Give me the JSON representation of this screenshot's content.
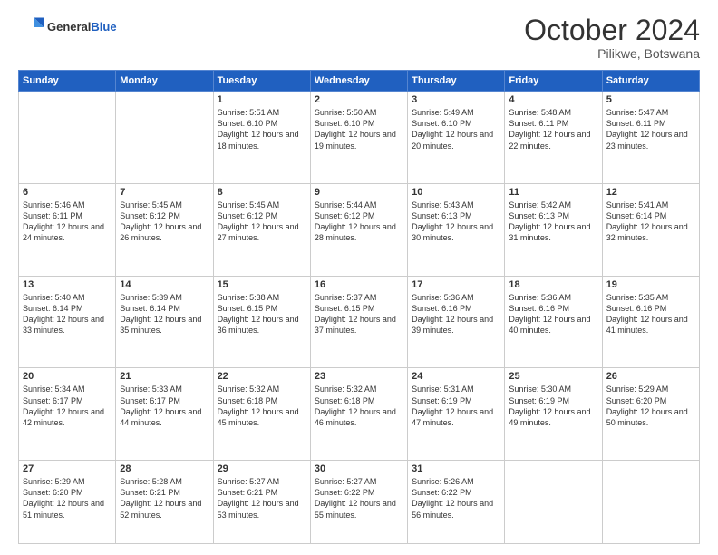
{
  "header": {
    "logo_general": "General",
    "logo_blue": "Blue",
    "month": "October 2024",
    "location": "Pilikwe, Botswana"
  },
  "days_of_week": [
    "Sunday",
    "Monday",
    "Tuesday",
    "Wednesday",
    "Thursday",
    "Friday",
    "Saturday"
  ],
  "weeks": [
    [
      {
        "day": "",
        "content": ""
      },
      {
        "day": "",
        "content": ""
      },
      {
        "day": "1",
        "content": "Sunrise: 5:51 AM\nSunset: 6:10 PM\nDaylight: 12 hours and 18 minutes."
      },
      {
        "day": "2",
        "content": "Sunrise: 5:50 AM\nSunset: 6:10 PM\nDaylight: 12 hours and 19 minutes."
      },
      {
        "day": "3",
        "content": "Sunrise: 5:49 AM\nSunset: 6:10 PM\nDaylight: 12 hours and 20 minutes."
      },
      {
        "day": "4",
        "content": "Sunrise: 5:48 AM\nSunset: 6:11 PM\nDaylight: 12 hours and 22 minutes."
      },
      {
        "day": "5",
        "content": "Sunrise: 5:47 AM\nSunset: 6:11 PM\nDaylight: 12 hours and 23 minutes."
      }
    ],
    [
      {
        "day": "6",
        "content": "Sunrise: 5:46 AM\nSunset: 6:11 PM\nDaylight: 12 hours and 24 minutes."
      },
      {
        "day": "7",
        "content": "Sunrise: 5:45 AM\nSunset: 6:12 PM\nDaylight: 12 hours and 26 minutes."
      },
      {
        "day": "8",
        "content": "Sunrise: 5:45 AM\nSunset: 6:12 PM\nDaylight: 12 hours and 27 minutes."
      },
      {
        "day": "9",
        "content": "Sunrise: 5:44 AM\nSunset: 6:12 PM\nDaylight: 12 hours and 28 minutes."
      },
      {
        "day": "10",
        "content": "Sunrise: 5:43 AM\nSunset: 6:13 PM\nDaylight: 12 hours and 30 minutes."
      },
      {
        "day": "11",
        "content": "Sunrise: 5:42 AM\nSunset: 6:13 PM\nDaylight: 12 hours and 31 minutes."
      },
      {
        "day": "12",
        "content": "Sunrise: 5:41 AM\nSunset: 6:14 PM\nDaylight: 12 hours and 32 minutes."
      }
    ],
    [
      {
        "day": "13",
        "content": "Sunrise: 5:40 AM\nSunset: 6:14 PM\nDaylight: 12 hours and 33 minutes."
      },
      {
        "day": "14",
        "content": "Sunrise: 5:39 AM\nSunset: 6:14 PM\nDaylight: 12 hours and 35 minutes."
      },
      {
        "day": "15",
        "content": "Sunrise: 5:38 AM\nSunset: 6:15 PM\nDaylight: 12 hours and 36 minutes."
      },
      {
        "day": "16",
        "content": "Sunrise: 5:37 AM\nSunset: 6:15 PM\nDaylight: 12 hours and 37 minutes."
      },
      {
        "day": "17",
        "content": "Sunrise: 5:36 AM\nSunset: 6:16 PM\nDaylight: 12 hours and 39 minutes."
      },
      {
        "day": "18",
        "content": "Sunrise: 5:36 AM\nSunset: 6:16 PM\nDaylight: 12 hours and 40 minutes."
      },
      {
        "day": "19",
        "content": "Sunrise: 5:35 AM\nSunset: 6:16 PM\nDaylight: 12 hours and 41 minutes."
      }
    ],
    [
      {
        "day": "20",
        "content": "Sunrise: 5:34 AM\nSunset: 6:17 PM\nDaylight: 12 hours and 42 minutes."
      },
      {
        "day": "21",
        "content": "Sunrise: 5:33 AM\nSunset: 6:17 PM\nDaylight: 12 hours and 44 minutes."
      },
      {
        "day": "22",
        "content": "Sunrise: 5:32 AM\nSunset: 6:18 PM\nDaylight: 12 hours and 45 minutes."
      },
      {
        "day": "23",
        "content": "Sunrise: 5:32 AM\nSunset: 6:18 PM\nDaylight: 12 hours and 46 minutes."
      },
      {
        "day": "24",
        "content": "Sunrise: 5:31 AM\nSunset: 6:19 PM\nDaylight: 12 hours and 47 minutes."
      },
      {
        "day": "25",
        "content": "Sunrise: 5:30 AM\nSunset: 6:19 PM\nDaylight: 12 hours and 49 minutes."
      },
      {
        "day": "26",
        "content": "Sunrise: 5:29 AM\nSunset: 6:20 PM\nDaylight: 12 hours and 50 minutes."
      }
    ],
    [
      {
        "day": "27",
        "content": "Sunrise: 5:29 AM\nSunset: 6:20 PM\nDaylight: 12 hours and 51 minutes."
      },
      {
        "day": "28",
        "content": "Sunrise: 5:28 AM\nSunset: 6:21 PM\nDaylight: 12 hours and 52 minutes."
      },
      {
        "day": "29",
        "content": "Sunrise: 5:27 AM\nSunset: 6:21 PM\nDaylight: 12 hours and 53 minutes."
      },
      {
        "day": "30",
        "content": "Sunrise: 5:27 AM\nSunset: 6:22 PM\nDaylight: 12 hours and 55 minutes."
      },
      {
        "day": "31",
        "content": "Sunrise: 5:26 AM\nSunset: 6:22 PM\nDaylight: 12 hours and 56 minutes."
      },
      {
        "day": "",
        "content": ""
      },
      {
        "day": "",
        "content": ""
      }
    ]
  ]
}
